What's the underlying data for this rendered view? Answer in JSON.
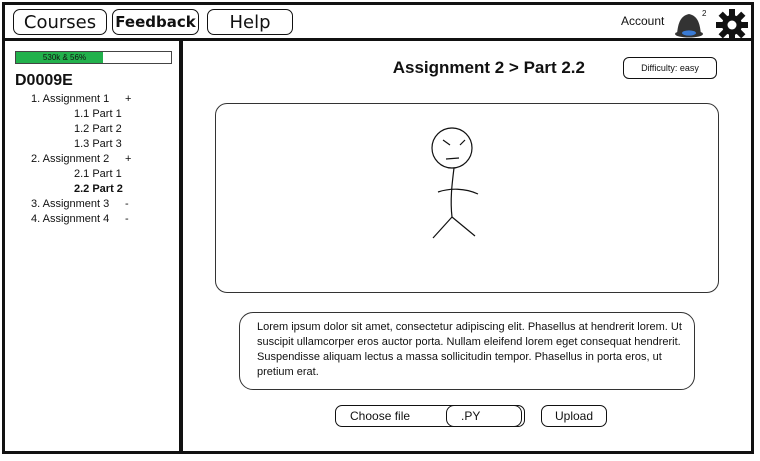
{
  "nav": {
    "courses": "Courses",
    "feedback": "Feedback",
    "help": "Help",
    "account": "Account",
    "notifications_count": "2"
  },
  "sidebar": {
    "progress_text": "530k & 56%",
    "progress_fraction": 0.56,
    "course_code": "D0009E",
    "tree": [
      {
        "label": "1. Assignment 1",
        "expander": "+",
        "active": false
      },
      {
        "label": "1.1 Part 1",
        "active": false
      },
      {
        "label": "1.2 Part 2",
        "active": false
      },
      {
        "label": "1.3 Part 3",
        "active": false
      },
      {
        "label": "2. Assignment 2",
        "expander": "+",
        "active": false
      },
      {
        "label": "2.1 Part 1",
        "active": false
      },
      {
        "label": "2.2 Part 2",
        "active": true
      },
      {
        "label": "3. Assignment 3",
        "expander": "-",
        "active": false
      },
      {
        "label": "4. Assignment 4",
        "expander": "-",
        "active": false
      }
    ]
  },
  "main": {
    "title": "Assignment 2 > Part 2.2",
    "difficulty": "Difficulty: easy",
    "description": "Lorem ipsum dolor sit amet, consectetur adipiscing elit. Phasellus at hendrerit lorem. Ut suscipit ullamcorper eros auctor porta. Nullam eleifend lorem eget consequat hendrerit. Suspendisse aliquam lectus a massa sollicitudin tempor. Phasellus in porta eros, ut pretium erat.",
    "choose_file": "Choose file",
    "file_ext": ".PY",
    "upload": "Upload"
  },
  "icons": {
    "bell": "bell-icon",
    "gear": "gear-icon",
    "bell_color": "#333333",
    "bell_accent": "#3a7bd5",
    "progress_color": "#22b14c"
  }
}
